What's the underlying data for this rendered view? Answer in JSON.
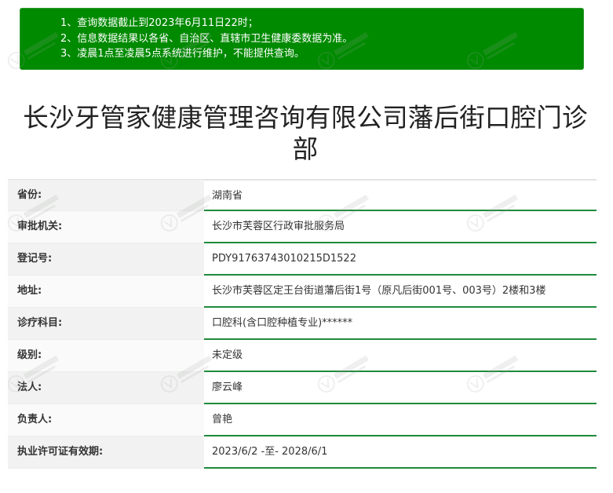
{
  "notice": {
    "lines": [
      "1、查询数据截止到2023年6月11日22时；",
      "2、信息数据结果以各省、自治区、直辖市卫生健康委数据为准。",
      "3、凌晨1点至凌晨5点系统进行维护，不能提供查询。"
    ]
  },
  "title": "长沙牙管家健康管理咨询有限公司藩后街口腔门诊部",
  "rows": [
    {
      "label": "省份:",
      "value": "湖南省"
    },
    {
      "label": "审批机关:",
      "value": "长沙市芙蓉区行政审批服务局"
    },
    {
      "label": "登记号:",
      "value": "PDY91763743010215D1522"
    },
    {
      "label": "地址:",
      "value": "长沙市芙蓉区定王台街道藩后街1号（原凡后街001号、003号）2楼和3楼"
    },
    {
      "label": "诊疗科目:",
      "value": "口腔科(含口腔种植专业)******"
    },
    {
      "label": "级别:",
      "value": "未定级"
    },
    {
      "label": "法人:",
      "value": "廖云峰"
    },
    {
      "label": "负责人:",
      "value": "曾艳"
    },
    {
      "label": "执业许可证有效期:",
      "value": "2023/6/2 -至- 2028/6/1"
    }
  ],
  "watermark": {
    "text": "牙立特口腔",
    "color": "#9aa39a"
  }
}
